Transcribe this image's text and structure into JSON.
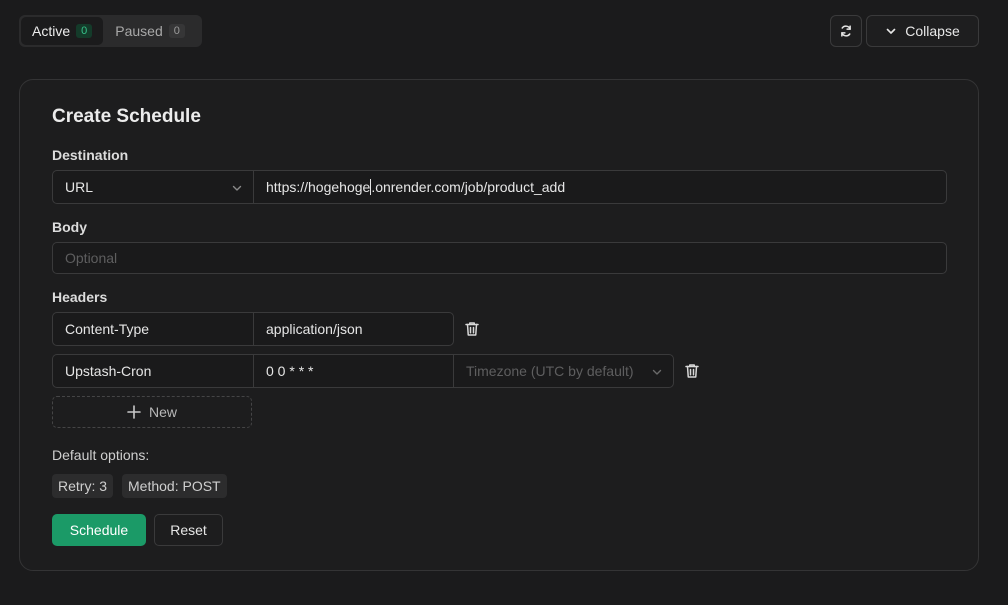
{
  "tabs": [
    {
      "label": "Active",
      "count": "0"
    },
    {
      "label": "Paused",
      "count": "0"
    }
  ],
  "toolbar": {
    "refresh_icon": "refresh-icon",
    "collapse_label": "Collapse"
  },
  "form": {
    "title": "Create Schedule",
    "destination": {
      "label": "Destination",
      "type_value": "URL",
      "url_before_cursor": "https://hogehoge",
      "url_after_cursor": ".onrender.com/job/product_add"
    },
    "body": {
      "label": "Body",
      "placeholder": "Optional"
    },
    "headers": {
      "label": "Headers",
      "rows": [
        {
          "key": "Content-Type",
          "value": "application/json"
        },
        {
          "key": "Upstash-Cron",
          "value": "0 0 * * *",
          "timezone_placeholder": "Timezone (UTC by default)"
        }
      ],
      "new_label": "New"
    },
    "default_options": {
      "label": "Default options:",
      "chips": [
        "Retry: 3",
        "Method: POST"
      ]
    },
    "schedule_label": "Schedule",
    "reset_label": "Reset"
  },
  "colors": {
    "accent": "#1b9a67",
    "background": "#1b1b1c"
  }
}
